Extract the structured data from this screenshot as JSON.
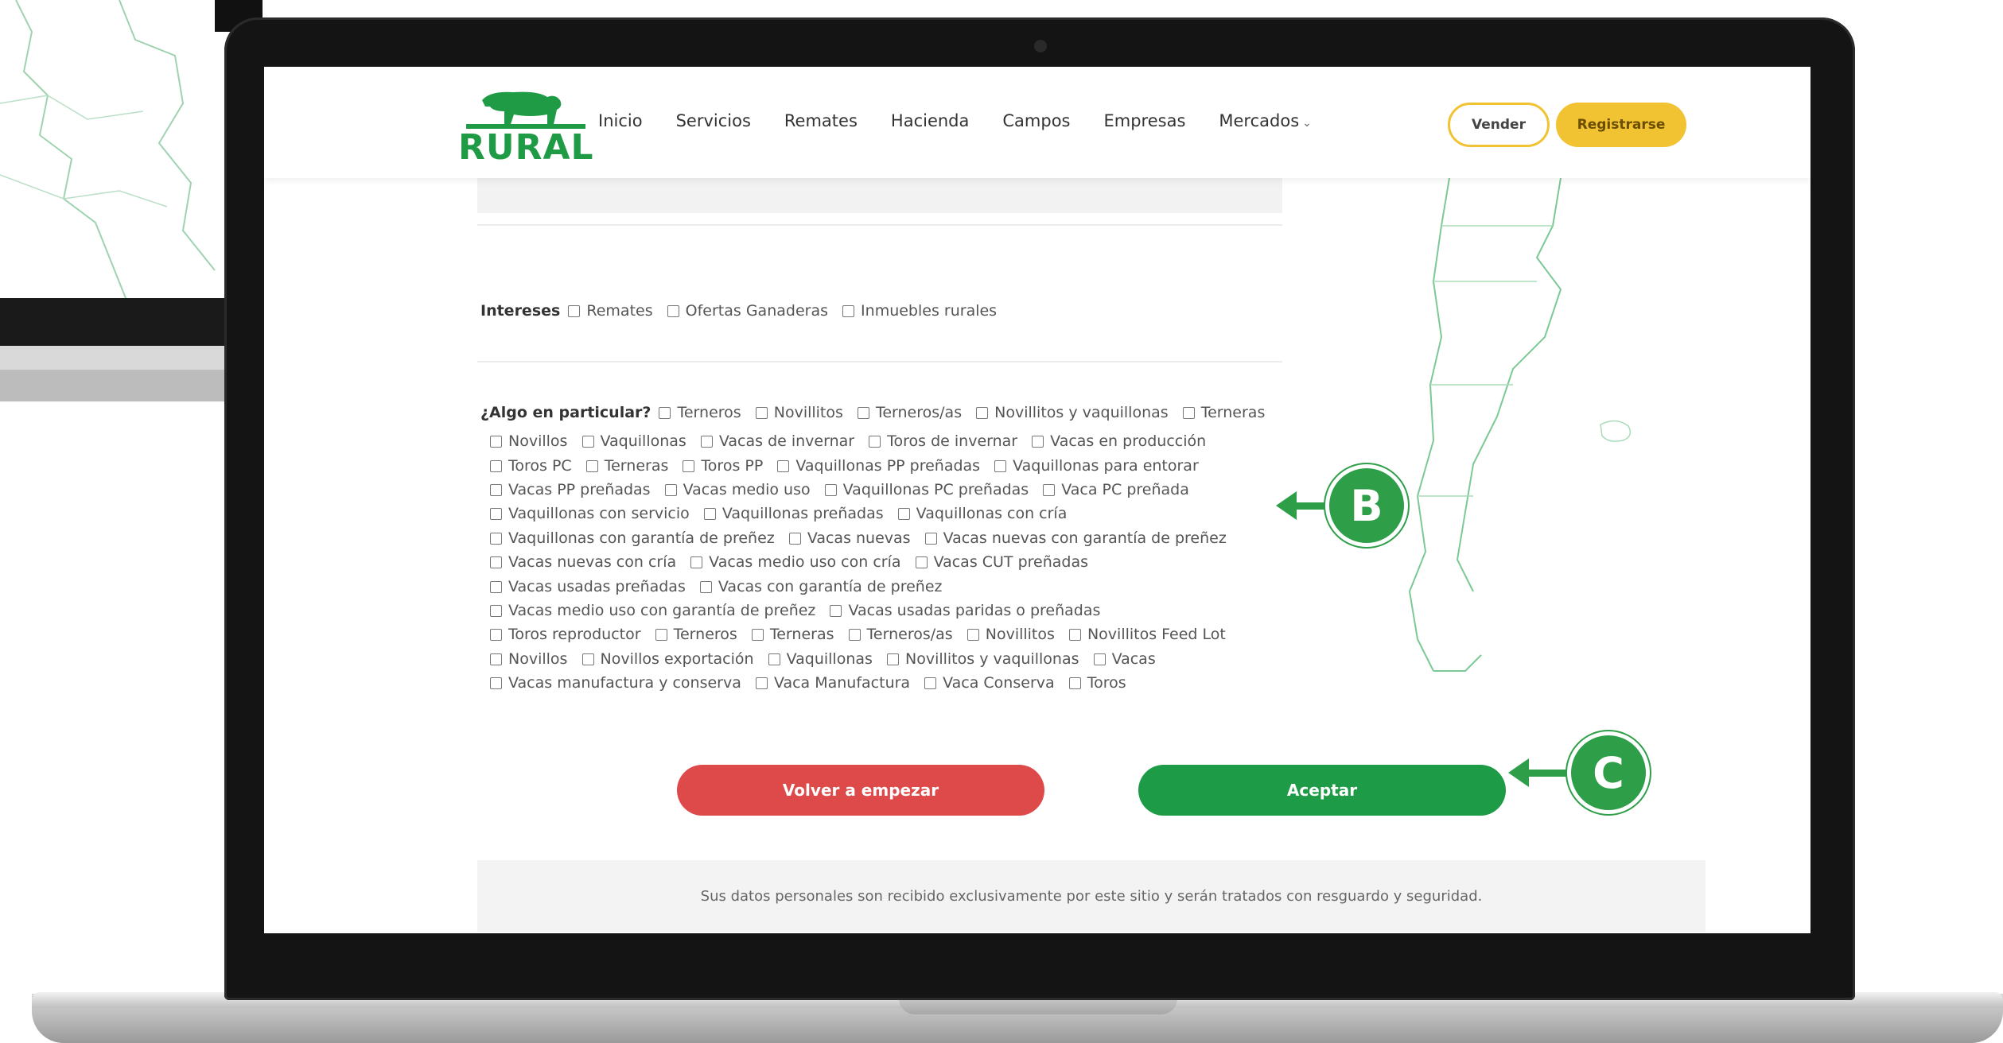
{
  "nav": {
    "logo_text": "RURAL",
    "links": [
      "Inicio",
      "Servicios",
      "Remates",
      "Hacienda",
      "Campos",
      "Empresas",
      "Mercados"
    ],
    "vender": "Vender",
    "registrarse": "Registrarse"
  },
  "intereses": {
    "label": "Intereses",
    "options": [
      "Remates",
      "Ofertas Ganaderas",
      "Inmuebles rurales"
    ]
  },
  "algo": {
    "label": "¿Algo en particular?",
    "lines": [
      [
        "Terneros",
        "Novillitos",
        "Terneros/as",
        "Novillitos y vaquillonas",
        "Terneras"
      ],
      [
        "Novillos",
        "Vaquillonas",
        "Vacas de invernar",
        "Toros de invernar",
        "Vacas en producción"
      ],
      [
        "Toros PC",
        "Terneras",
        "Toros PP",
        "Vaquillonas PP preñadas",
        "Vaquillonas para entorar"
      ],
      [
        "Vacas PP preñadas",
        "Vacas medio uso",
        "Vaquillonas PC preñadas",
        "Vaca PC preñada"
      ],
      [
        "Vaquillonas con servicio",
        "Vaquillonas preñadas",
        "Vaquillonas con cría"
      ],
      [
        "Vaquillonas con garantía de preñez",
        "Vacas nuevas",
        "Vacas nuevas con garantía de preñez"
      ],
      [
        "Vacas nuevas con cría",
        "Vacas medio uso con cría",
        "Vacas CUT preñadas"
      ],
      [
        "Vacas usadas preñadas",
        "Vacas con garantía de preñez"
      ],
      [
        "Vacas medio uso con garantía de preñez",
        "Vacas usadas paridas o preñadas"
      ],
      [
        "Toros reproductor",
        "Terneros",
        "Terneras",
        "Terneros/as",
        "Novillitos",
        "Novillitos Feed Lot"
      ],
      [
        "Novillos",
        "Novillos exportación",
        "Vaquillonas",
        "Novillitos y vaquillonas",
        "Vacas"
      ],
      [
        "Vacas manufactura y conserva",
        "Vaca Manufactura",
        "Vaca Conserva",
        "Toros"
      ]
    ]
  },
  "buttons": {
    "volver": "Volver a empezar",
    "aceptar": "Aceptar"
  },
  "privacy": "Sus datos personales son recibido exclusivamente por este sitio y serán tratados con resguardo y seguridad.",
  "callouts": {
    "b": "B",
    "c": "C"
  },
  "colors": {
    "brand_green": "#1f9a45",
    "accent_yellow": "#f1c232",
    "danger_red": "#de4a4a",
    "callout_green": "#2e9e48"
  }
}
